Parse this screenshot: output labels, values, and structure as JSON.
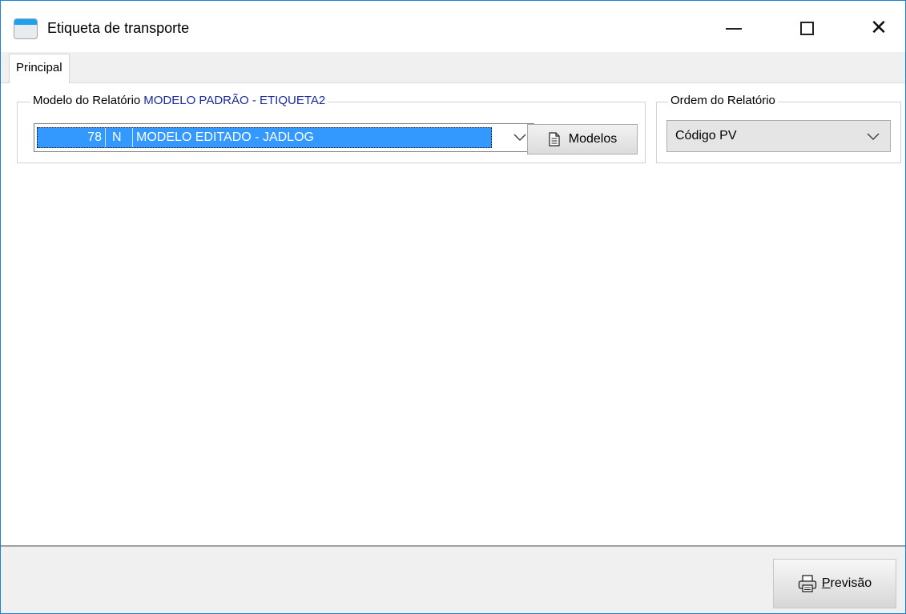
{
  "window": {
    "title": "Etiqueta de transporte",
    "accent": "#1883d7"
  },
  "tabs": [
    {
      "label": "Principal"
    }
  ],
  "report_model": {
    "label": "Modelo do Relatório",
    "current_model": "MODELO PADRÃO - ETIQUETA2",
    "selected": {
      "code": "78",
      "flag": "N",
      "name": "MODELO EDITADO - JADLOG"
    },
    "models_button": "Modelos",
    "selection_color": "#3399ff"
  },
  "report_order": {
    "label": "Ordem do Relatório",
    "value": "Código PV"
  },
  "footer": {
    "preview_first": "P",
    "preview_rest": "revisão"
  },
  "icons": {
    "app": "app-window-icon",
    "minimize": "minimize-icon",
    "maximize": "maximize-icon",
    "close": "close-icon",
    "document": "document-icon",
    "printer": "printer-icon",
    "chevron": "chevron-down-icon"
  }
}
